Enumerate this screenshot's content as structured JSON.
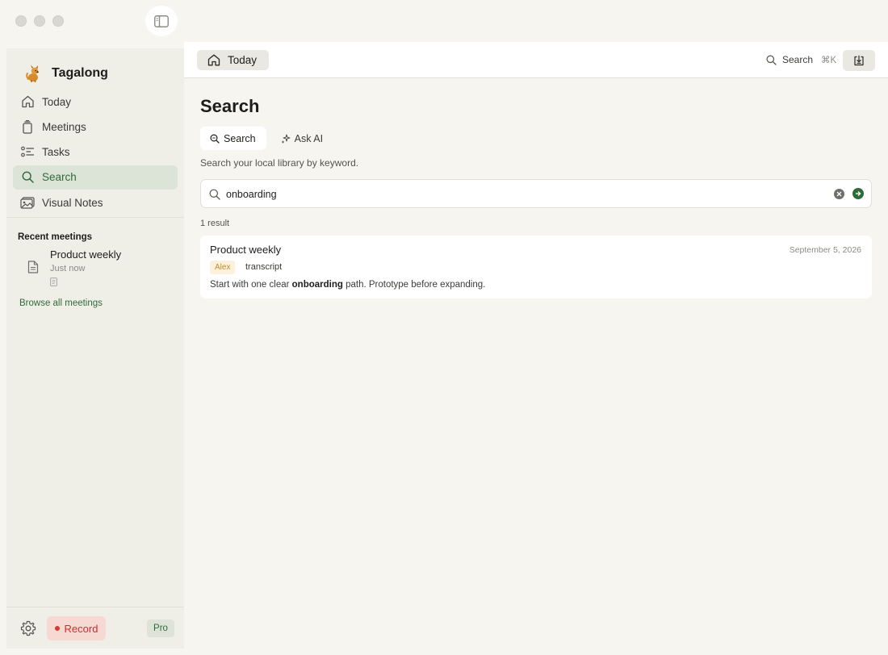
{
  "app": {
    "name": "Tagalong",
    "colors": {
      "accent": "#2f6b3a",
      "record": "#c9302c",
      "speaker_tag": "#c48a2a"
    }
  },
  "titlebar": {
    "icons": [
      "close-button",
      "minimize-button",
      "zoom-button",
      "sidebar-toggle-icon"
    ]
  },
  "sidebar": {
    "nav": [
      {
        "label": "Today",
        "icon": "home-icon"
      },
      {
        "label": "Meetings",
        "icon": "meetings-icon"
      },
      {
        "label": "Tasks",
        "icon": "tasks-icon"
      },
      {
        "label": "Search",
        "icon": "search-icon",
        "active": true
      },
      {
        "label": "Visual Notes",
        "icon": "visual-notes-icon"
      }
    ],
    "recent_title": "Recent meetings",
    "recent": [
      {
        "name": "Product weekly",
        "time": "Just now",
        "icon": "document-icon"
      }
    ],
    "browse_label": "Browse all meetings",
    "footer": {
      "record_label": "Record",
      "pro_label": "Pro"
    }
  },
  "topbar": {
    "breadcrumb_label": "Today",
    "search_label": "Search",
    "search_shortcut": "⌘K"
  },
  "main": {
    "title": "Search",
    "tabs": [
      {
        "label": "Search",
        "active": true,
        "icon": "search-zoom-icon"
      },
      {
        "label": "Ask AI",
        "active": false,
        "icon": "sparkle-icon"
      }
    ],
    "subtitle": "Search your local library by keyword.",
    "search": {
      "value": "onboarding",
      "placeholder": ""
    },
    "result_count": "1 result",
    "results": [
      {
        "title": "Product weekly",
        "date": "September 5, 2026",
        "speaker": "Alex",
        "source": "transcript",
        "snippet_before": "Start with one clear ",
        "snippet_match": "onboarding",
        "snippet_after": " path. Prototype before expanding."
      }
    ]
  }
}
